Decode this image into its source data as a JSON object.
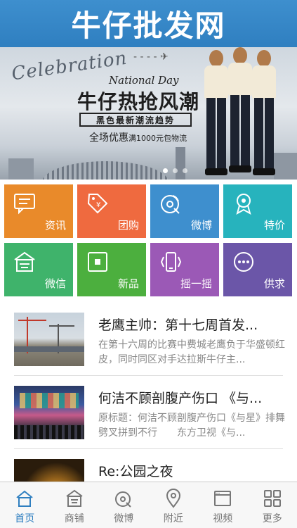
{
  "header": {
    "title": "牛仔批发网"
  },
  "banner": {
    "script_text": "Celebration",
    "subtitle": "National Day",
    "headline": "牛仔热抢风潮",
    "tagline": "黑色最新潮流趋势",
    "promo_main": "全场优惠",
    "promo_small": "满1000元包物流",
    "slides": 3,
    "active_slide": 1
  },
  "tiles": [
    {
      "label": "资讯",
      "icon": "message-icon",
      "color": "#e98a2a"
    },
    {
      "label": "团购",
      "icon": "price-tag-icon",
      "color": "#ef6a3f"
    },
    {
      "label": "微博",
      "icon": "weibo-icon",
      "color": "#3e8fce"
    },
    {
      "label": "特价",
      "icon": "ribbon-badge-icon",
      "color": "#27b3bd"
    },
    {
      "label": "微信",
      "icon": "shop-icon",
      "color": "#3fb36b"
    },
    {
      "label": "新品",
      "icon": "new-box-icon",
      "color": "#4caf3e"
    },
    {
      "label": "摇一摇",
      "icon": "shake-phone-icon",
      "color": "#9b59b6"
    },
    {
      "label": "供求",
      "icon": "more-dots-icon",
      "color": "#6b56a8"
    }
  ],
  "news": [
    {
      "title": "老鹰主帅：第十七周首发...",
      "desc": "在第十六周的比赛中费城老鹰负于华盛顿红皮，同时同区对手达拉斯牛仔主..."
    },
    {
      "title": "何洁不顾剖腹产伤口 《与...",
      "desc": "原标题：何洁不顾剖腹产伤口《与星》排舞劈叉拼到不行　　东方卫视《与..."
    },
    {
      "title": "Re:公园之夜",
      "desc": ""
    }
  ],
  "tabbar": [
    {
      "label": "首页",
      "icon": "home-icon",
      "active": true
    },
    {
      "label": "商铺",
      "icon": "store-icon",
      "active": false
    },
    {
      "label": "微博",
      "icon": "weibo-icon",
      "active": false
    },
    {
      "label": "附近",
      "icon": "location-pin-icon",
      "active": false
    },
    {
      "label": "视频",
      "icon": "video-icon",
      "active": false
    },
    {
      "label": "更多",
      "icon": "grid-more-icon",
      "active": false
    }
  ],
  "colors": {
    "brand_blue": "#2f7fc0",
    "text_gray": "#888888"
  }
}
